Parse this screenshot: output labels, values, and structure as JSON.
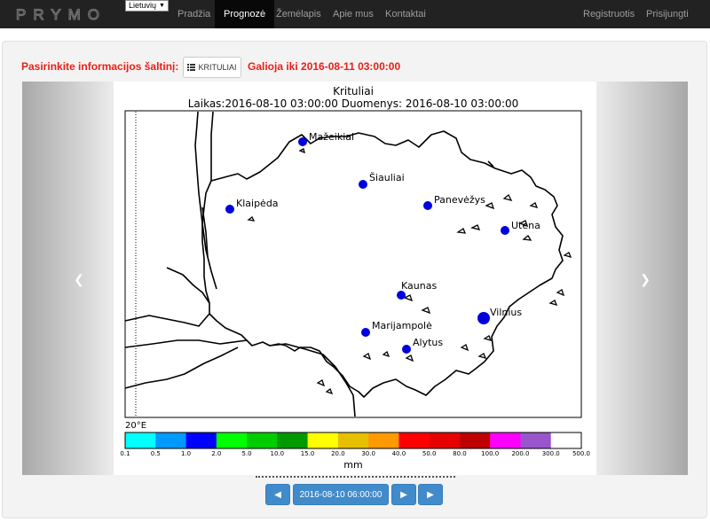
{
  "navbar": {
    "logo_text": "PRYMO",
    "language": "Lietuvių",
    "items": [
      {
        "label": "Pradžia",
        "active": false
      },
      {
        "label": "Prognozė",
        "active": true
      },
      {
        "label": "Žemėlapis",
        "active": false
      },
      {
        "label": "Apie mus",
        "active": false
      },
      {
        "label": "Kontaktai",
        "active": false
      }
    ],
    "right_items": [
      {
        "label": "Registruotis"
      },
      {
        "label": "Prisijungti"
      }
    ]
  },
  "source": {
    "label": "Pasirinkite informacijos šaltinį:",
    "button_label": "KRITULIAI",
    "valid_until": "Galioja iki 2016-08-11 03:00:00"
  },
  "map": {
    "title": "Krituliai",
    "subtitle": "Laikas:2016-08-10 03:00:00 Duomenys: 2016-08-10 03:00:00",
    "meridian_label": "20°E",
    "cities": [
      {
        "name": "Mažeikiai"
      },
      {
        "name": "Šiauliai"
      },
      {
        "name": "Klaipėda"
      },
      {
        "name": "Panevėžys"
      },
      {
        "name": "Utena"
      },
      {
        "name": "Kaunas"
      },
      {
        "name": "Vilnius"
      },
      {
        "name": "Marijampolė"
      },
      {
        "name": "Alytus"
      }
    ],
    "colorbar": {
      "unit": "mm",
      "ticks": [
        "0.1",
        "0.5",
        "1.0",
        "2.0",
        "5.0",
        "10.0",
        "15.0",
        "20.0",
        "30.0",
        "40.0",
        "50.0",
        "80.0",
        "100.0",
        "200.0",
        "300.0",
        "500.0"
      ],
      "colors": [
        "#00ffff",
        "#0099ff",
        "#0000ff",
        "#00ff00",
        "#00cc00",
        "#009900",
        "#ffff00",
        "#e6bf00",
        "#ff9900",
        "#ff0000",
        "#e60000",
        "#bf0000",
        "#ff00ff",
        "#9955cc",
        "#ffffff"
      ]
    }
  },
  "controls": {
    "prev_label": "◀",
    "date_label": "2016-08-10 06:00:00",
    "next_label": "▶",
    "play_label": "▶"
  }
}
